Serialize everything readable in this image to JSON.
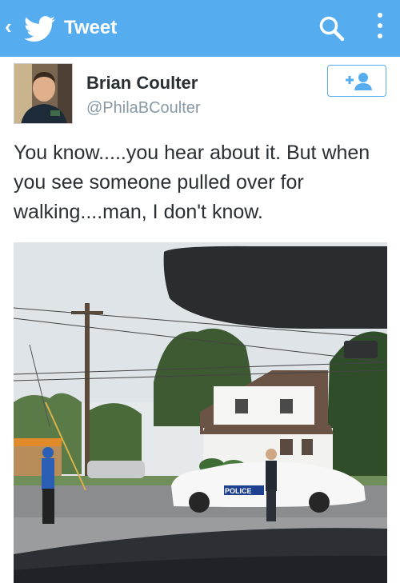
{
  "topbar": {
    "title": "Tweet",
    "back_icon": "chevron-left-icon",
    "logo_icon": "twitter-bird-icon",
    "search_icon": "search-icon",
    "more_icon": "more-vertical-icon",
    "color": "#55acee"
  },
  "tweet": {
    "author_name": "Brian Coulter",
    "author_handle": "@PhilaBCoulter",
    "follow_icon": "add-user-icon",
    "text": "You know.....you hear about it. But when you see someone pulled over for walking....man, I don't know."
  },
  "photo": {
    "car_label": "POLICE"
  }
}
